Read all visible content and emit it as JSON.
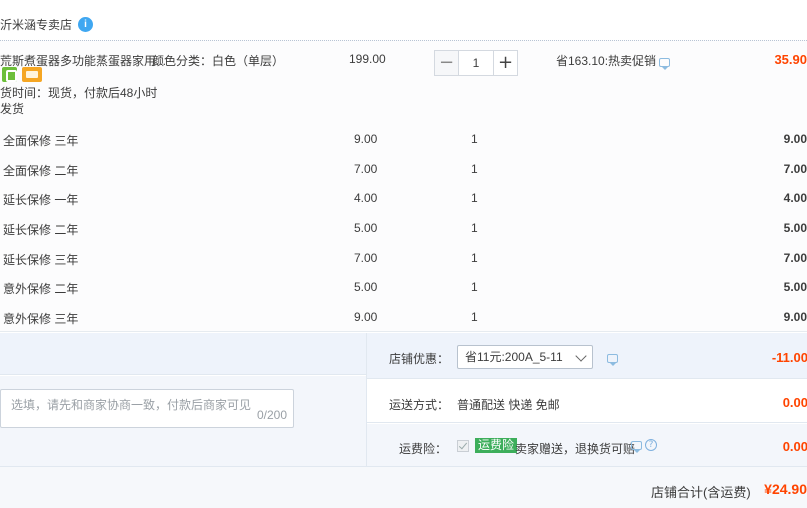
{
  "shop": {
    "name": "沂米涵专卖店",
    "badge_icon": "shop-badge-icon",
    "badge_glyph": "i"
  },
  "item": {
    "title": "荒斯煮蛋器多功能蒸蛋器家用...",
    "spec": "颜色分类：白色（单层）",
    "price": "199.00",
    "tag_icons": [
      "guarantee-icon",
      "card-icon"
    ],
    "delivery_line1": "货时间：现货，付款后48小时",
    "delivery_line2": "发货",
    "quantity": "1",
    "minus_glyph": "−",
    "plus_glyph": "+",
    "promo": "省163.10:热卖促销",
    "total": "35.90"
  },
  "services": [
    {
      "name": "全面保修 三年",
      "price": "9.00",
      "qty": "1",
      "total": "9.00"
    },
    {
      "name": "全面保修 二年",
      "price": "7.00",
      "qty": "1",
      "total": "7.00"
    },
    {
      "name": "延长保修 一年",
      "price": "4.00",
      "qty": "1",
      "total": "4.00"
    },
    {
      "name": "延长保修 二年",
      "price": "5.00",
      "qty": "1",
      "total": "5.00"
    },
    {
      "name": "延长保修 三年",
      "price": "7.00",
      "qty": "1",
      "total": "7.00"
    },
    {
      "name": "意外保修 二年",
      "price": "5.00",
      "qty": "1",
      "total": "5.00"
    },
    {
      "name": "意外保修 三年",
      "price": "9.00",
      "qty": "1",
      "total": "9.00"
    }
  ],
  "memo": {
    "placeholder": "选填，请先和商家协商一致，付款后商家可见",
    "counter": "0/200"
  },
  "coupon": {
    "label": "店铺优惠：",
    "selected": "省11元:200A_5-11",
    "amount": "-11.00"
  },
  "shipping": {
    "label": "运送方式：",
    "value": "普通配送 快递 免邮",
    "amount": "0.00"
  },
  "insurance": {
    "label": "运费险：",
    "badge": "运费险",
    "text": "卖家赠送，退换货可赔",
    "help_glyph": "?",
    "amount": "0.00"
  },
  "footer": {
    "label": "店铺合计(含运费)",
    "amount": "¥24.90"
  },
  "colors": {
    "accent_red": "#ff4400",
    "badge_green": "#3dae5b",
    "shop_badge_blue": "#3fa7f1"
  }
}
